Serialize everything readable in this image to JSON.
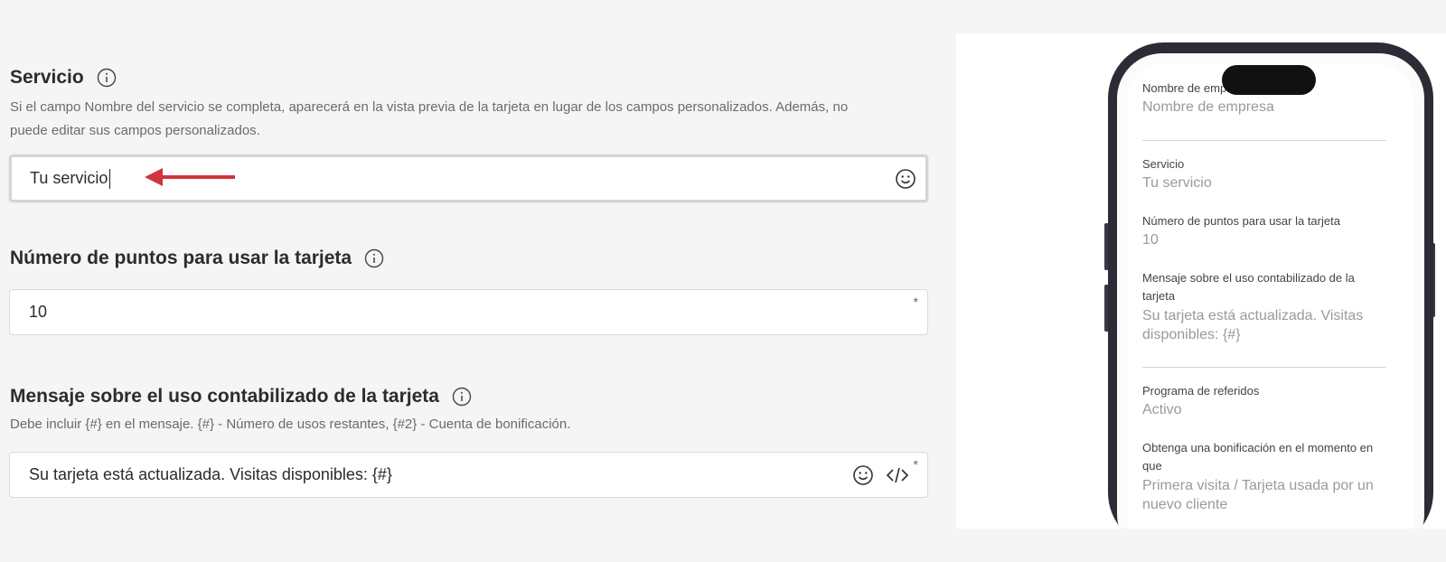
{
  "servicio": {
    "title": "Servicio",
    "description_line1": "Si el campo Nombre del servicio se completa, aparecerá en la vista previa de la tarjeta en lugar de los campos personalizados. Además, no",
    "description_line2": "puede editar sus campos personalizados.",
    "value": "Tu servicio"
  },
  "puntos": {
    "title": "Número de puntos para usar la tarjeta",
    "value": "10",
    "required_mark": "*"
  },
  "mensaje": {
    "title": "Mensaje sobre el uso contabilizado de la tarjeta",
    "description": "Debe incluir {#} en el mensaje. {#} - Número de usos restantes, {#2} - Cuenta de bonificación.",
    "value": "Su tarjeta está actualizada. Visitas disponibles: {#}",
    "required_mark": "*"
  },
  "preview": {
    "empresa_label": "Nombre de empresa",
    "empresa_value": "Nombre de empresa",
    "servicio_label": "Servicio",
    "servicio_value": "Tu servicio",
    "puntos_label": "Número de puntos para usar la tarjeta",
    "puntos_value": "10",
    "mensaje_label": "Mensaje sobre el uso contabilizado de la tarjeta",
    "mensaje_value": "Su tarjeta está actualizada. Visitas disponibles: {#}",
    "referidos_label": "Programa de referidos",
    "referidos_value": "Activo",
    "bonificacion_label": "Obtenga una bonificación en el momento en que",
    "bonificacion_value": "Primera visita / Tarjeta usada por un nuevo cliente"
  },
  "icons": {
    "info": "info-icon",
    "emoji": "emoji-icon",
    "code": "code-icon",
    "arrow": "arrow-icon"
  },
  "colors": {
    "arrow": "#d0343c",
    "phone_frame": "#2d2b36"
  }
}
